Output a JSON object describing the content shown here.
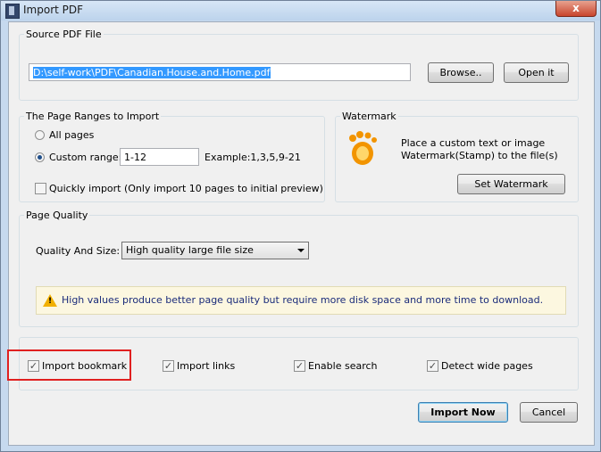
{
  "window": {
    "title": "Import PDF",
    "close_glyph": "x"
  },
  "source": {
    "legend": "Source PDF File",
    "path": "D:\\self-work\\PDF\\Canadian.House.and.Home.pdf",
    "browse_label": "Browse..",
    "open_label": "Open it"
  },
  "ranges": {
    "legend": "The Page Ranges to Import",
    "all_pages_label": "All pages",
    "custom_label": "Custom range:",
    "custom_value": "1-12",
    "example_text": "Example:1,3,5,9-21",
    "selected": "custom",
    "quick_label": "Quickly import (Only import 10 pages to  initial  preview)",
    "quick_checked": false
  },
  "watermark": {
    "legend": "Watermark",
    "desc_line1": "Place a custom text or image",
    "desc_line2": "Watermark(Stamp) to the file(s)",
    "button_label": "Set Watermark"
  },
  "quality": {
    "legend": "Page Quality",
    "label": "Quality And Size:",
    "selected": "High quality large file size",
    "info": "High values produce better page quality but require more disk space and more time to download."
  },
  "options": [
    {
      "label": "Import bookmark",
      "checked": true
    },
    {
      "label": "Import links",
      "checked": true
    },
    {
      "label": "Enable search",
      "checked": true
    },
    {
      "label": "Detect wide pages",
      "checked": true
    }
  ],
  "footer": {
    "import_label": "Import Now",
    "cancel_label": "Cancel"
  },
  "colors": {
    "highlight": "#e02020",
    "selection": "#3399ff",
    "warning": "#f1b000"
  }
}
